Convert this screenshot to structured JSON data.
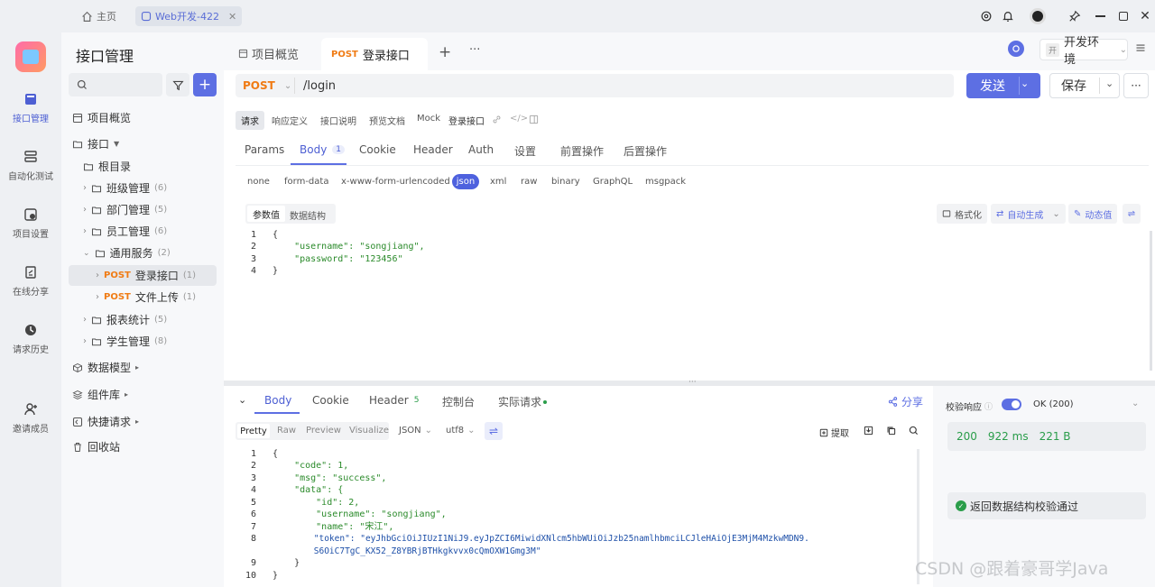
{
  "topbar": {
    "home_label": "主页",
    "project_tab": "Web开发-422"
  },
  "rail": {
    "items": [
      "接口管理",
      "自动化测试",
      "项目设置",
      "在线分享",
      "请求历史",
      "邀请成员"
    ]
  },
  "sidebar": {
    "title": "接口管理",
    "overview": "项目概览",
    "api": "接口",
    "root": "根目录",
    "folders": [
      {
        "label": "班级管理",
        "count": "(6)"
      },
      {
        "label": "部门管理",
        "count": "(5)"
      },
      {
        "label": "员工管理",
        "count": "(6)"
      },
      {
        "label": "通用服务",
        "count": "(2)"
      }
    ],
    "endpoints": [
      {
        "method": "POST",
        "label": "登录接口",
        "count": "(1)"
      },
      {
        "method": "POST",
        "label": "文件上传",
        "count": "(1)"
      }
    ],
    "folders2": [
      {
        "label": "报表统计",
        "count": "(5)"
      },
      {
        "label": "学生管理",
        "count": "(8)"
      }
    ],
    "data_model": "数据模型",
    "components": "组件库",
    "quick_request": "快捷请求",
    "trash": "回收站"
  },
  "main": {
    "tab_overview": "项目概览",
    "tab_method": "POST",
    "tab_title": "登录接口",
    "env": "开发环境",
    "env_badge": "开",
    "method": "POST",
    "url": "/login",
    "send": "发送",
    "save": "保存",
    "mode_tabs": [
      "请求",
      "响应定义",
      "接口说明",
      "预览文档",
      "Mock"
    ],
    "api_name": "登录接口",
    "req_tabs": [
      "Params",
      "Body",
      "Cookie",
      "Header",
      "Auth",
      "设置",
      "前置操作",
      "后置操作"
    ],
    "body_count": "1",
    "body_types": [
      "none",
      "form-data",
      "x-www-form-urlencoded",
      "json",
      "xml",
      "raw",
      "binary",
      "GraphQL",
      "msgpack"
    ],
    "param_tabs": [
      "参数值",
      "数据结构"
    ],
    "format": "格式化",
    "auto_gen": "自动生成",
    "dynamic": "动态值",
    "req_code": [
      "{",
      "    \"username\": \"songjiang\",",
      "    \"password\": \"123456\"",
      "}"
    ],
    "resp_tabs": [
      "Body",
      "Cookie",
      "Header",
      "控制台",
      "实际请求"
    ],
    "header_count": "5",
    "share": "分享",
    "view_tabs": [
      "Pretty",
      "Raw",
      "Preview",
      "Visualize"
    ],
    "json_select": "JSON",
    "encoding": "utf8",
    "extract": "提取",
    "resp_code": [
      "{",
      "    \"code\": 1,",
      "    \"msg\": \"success\",",
      "    \"data\": {",
      "        \"id\": 2,",
      "        \"username\": \"songjiang\",",
      "        \"name\": \"宋江\",",
      "        \"token\": \"eyJhbGciOiJIUzI1NiJ9.eyJpZCI6MiwidXNlcm5hbWUiOiJzb25namlhbmciLCJleHAiOjE3MjM4MzkwMDN9.",
      "        S6OiC7TgC_KX52_Z8YBRjBTHkgkvvx0cQmOXW1Gmg3M\"",
      "    }",
      "}"
    ],
    "resp_line_numbers": [
      "1",
      "2",
      "3",
      "4",
      "5",
      "6",
      "7",
      "8",
      "",
      "9",
      "10"
    ],
    "verify_label": "校验响应",
    "status_text": "OK (200)",
    "status_code": "200",
    "time": "922 ms",
    "size": "221 B",
    "verify_pass": "返回数据结构校验通过",
    "watermark": "CSDN @跟着豪哥学Java"
  },
  "colors": {
    "accent": "#5468e0",
    "post": "#f07b14",
    "success": "#2a9d4a"
  }
}
